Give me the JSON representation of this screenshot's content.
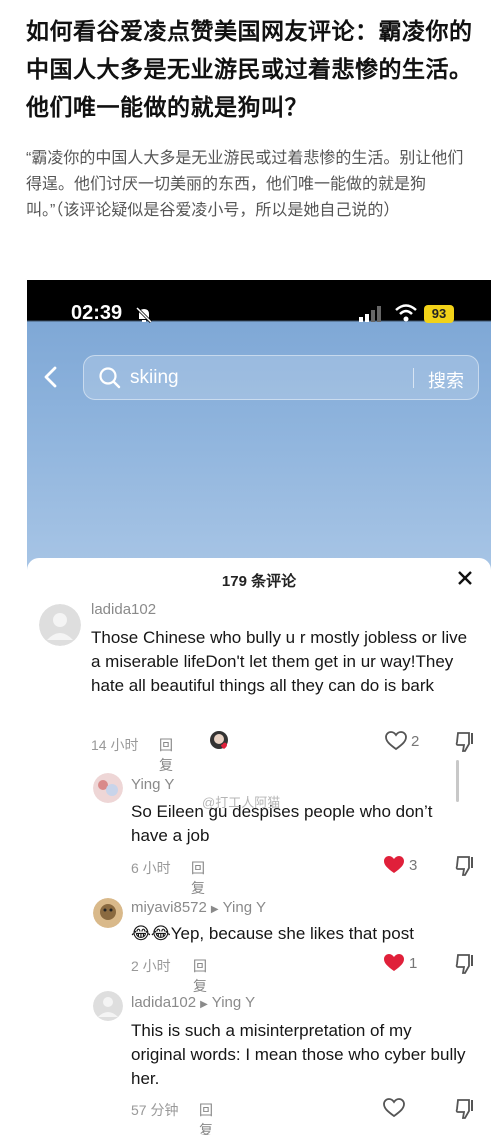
{
  "article": {
    "title": "如何看谷爱凌点赞美国网友评论：霸凌你的中国人大多是无业游民或过着悲惨的生活。他们唯一能做的就是狗叫？",
    "quote": "“霸凌你的中国人大多是无业游民或过着悲惨的生活。别让他们得逞。他们讨厌一切美丽的东西，他们唯一能做的就是狗叫。”（该评论疑似是谷爱凌小号，所以是她自己说的）"
  },
  "status_bar": {
    "time": "02:39",
    "battery": "93"
  },
  "search": {
    "query": "skiing",
    "button": "搜索"
  },
  "comments_panel": {
    "title": "179 条评论",
    "reply_label": "回复",
    "comments": [
      {
        "user": "ladida102",
        "text": "Those Chinese who bully u r mostly jobless or live a miserable lifeDon't let them get in ur way!They hate all beautiful things all they can do is bark",
        "time": "14 小时",
        "likes": "2"
      },
      {
        "user": "Ying Y",
        "text": "So Eileen gu despises people who don’t have a job",
        "time": "6 小时",
        "likes": "3"
      },
      {
        "user": "miyavi8572",
        "reply_to": "Ying Y",
        "emoji": "😂😂",
        "text": "Yep, because she likes that post",
        "time": "2 小时",
        "likes": "1"
      },
      {
        "user": "ladida102",
        "reply_to": "Ying Y",
        "text": "This is such a misinterpretation of my original words: I mean those who cyber bully her.",
        "time": "57 分钟",
        "likes": ""
      }
    ]
  },
  "watermark": "@打工人阿猫",
  "colors": {
    "liked": "#e0203a",
    "text": "#161616",
    "muted": "#999999"
  }
}
